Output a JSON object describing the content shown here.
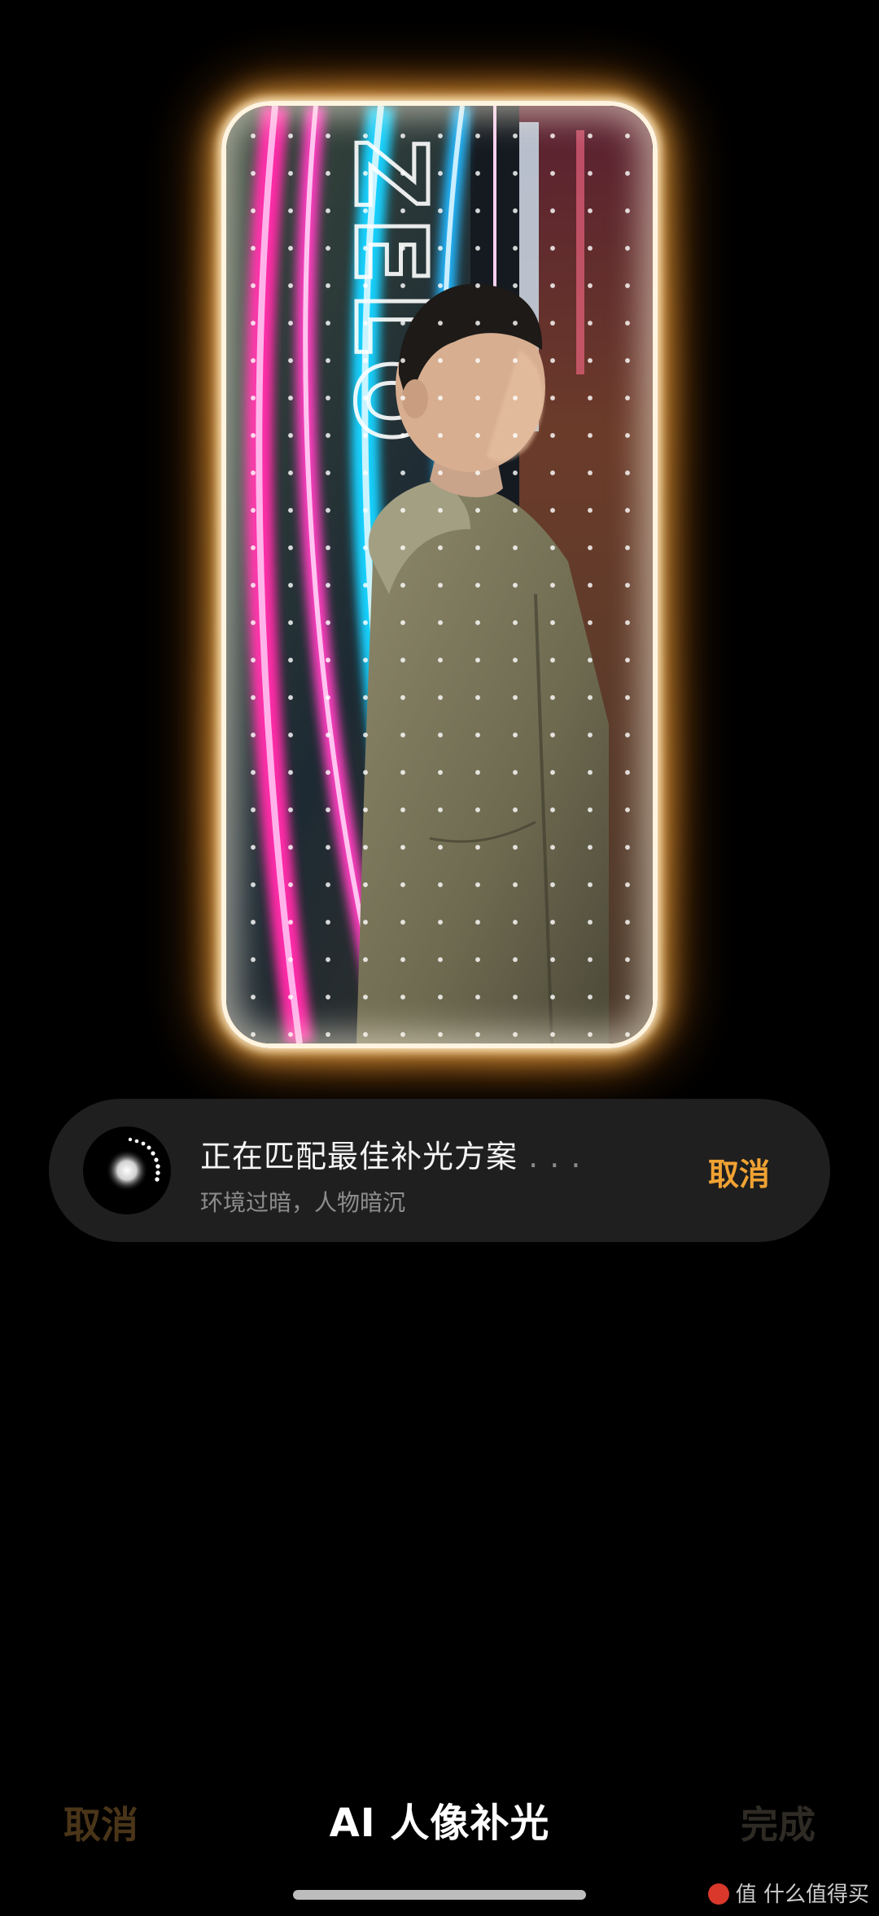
{
  "preview": {
    "sign_text": "ZELO"
  },
  "status": {
    "title": "正在匹配最佳补光方案",
    "title_dots": " . . .",
    "subtitle": "环境过暗，人物暗沉",
    "cancel_label": "取消"
  },
  "bottom_bar": {
    "cancel_label": "取消",
    "title": "AI 人像补光",
    "done_label": "完成"
  },
  "watermark": {
    "text": "值 什么值得买"
  },
  "colors": {
    "accent": "#f0a233",
    "card_bg": "#1f1f1f",
    "glow": "#ffb450"
  }
}
